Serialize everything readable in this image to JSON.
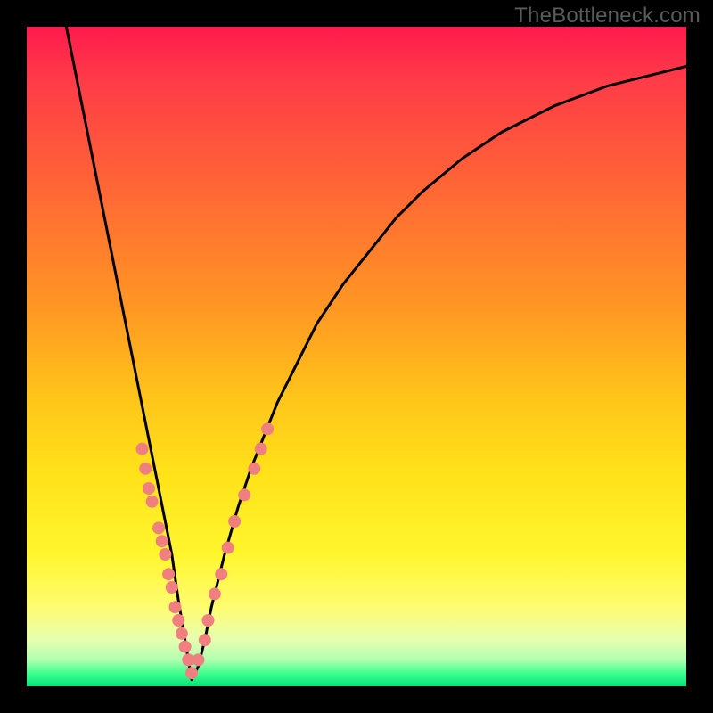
{
  "watermark": "TheBottleneck.com",
  "colors": {
    "frame_bg_top": "#ff1a4d",
    "frame_bg_bottom": "#00e676",
    "curve": "#000000",
    "dot_fill": "#f08080",
    "dot_stroke": "#c05050",
    "page_bg": "#000000",
    "watermark": "#5a5a5a"
  },
  "chart_data": {
    "type": "line",
    "title": "",
    "xlabel": "",
    "ylabel": "",
    "xlim": [
      0,
      100
    ],
    "ylim": [
      0,
      100
    ],
    "grid": false,
    "legend": false,
    "notes": "V-shaped bottleneck curve. x is normalized horizontal position (0–100), y is normalized vertical height from bottom (0–100). Minimum of curve ~ (25, 0). Scattered dots cluster along both arms of the V in the lower third.",
    "series": [
      {
        "name": "curve",
        "x": [
          6,
          8,
          10,
          12,
          14,
          16,
          18,
          20,
          22,
          23,
          24,
          25,
          26,
          27,
          28,
          30,
          32,
          34,
          36,
          38,
          40,
          44,
          48,
          52,
          56,
          60,
          66,
          72,
          80,
          88,
          96,
          100
        ],
        "y": [
          100,
          90,
          80,
          70,
          60,
          50,
          40,
          30,
          20,
          13,
          7,
          1,
          3,
          7,
          12,
          20,
          27,
          33,
          38,
          43,
          47,
          55,
          61,
          66,
          71,
          75,
          80,
          84,
          88,
          91,
          93,
          94
        ]
      },
      {
        "name": "dots",
        "x": [
          17.5,
          18,
          18.5,
          19,
          20,
          20.5,
          21,
          21.5,
          22,
          22.5,
          23,
          23.5,
          24,
          24.5,
          25,
          26,
          27,
          27.5,
          28.5,
          29.5,
          30.5,
          31.5,
          33,
          34.5,
          35.5,
          36.5
        ],
        "y": [
          36,
          33,
          30,
          28,
          24,
          22,
          20,
          17,
          15,
          12,
          10,
          8,
          6,
          4,
          2,
          4,
          7,
          10,
          14,
          17,
          21,
          25,
          29,
          33,
          36,
          39
        ]
      }
    ]
  }
}
